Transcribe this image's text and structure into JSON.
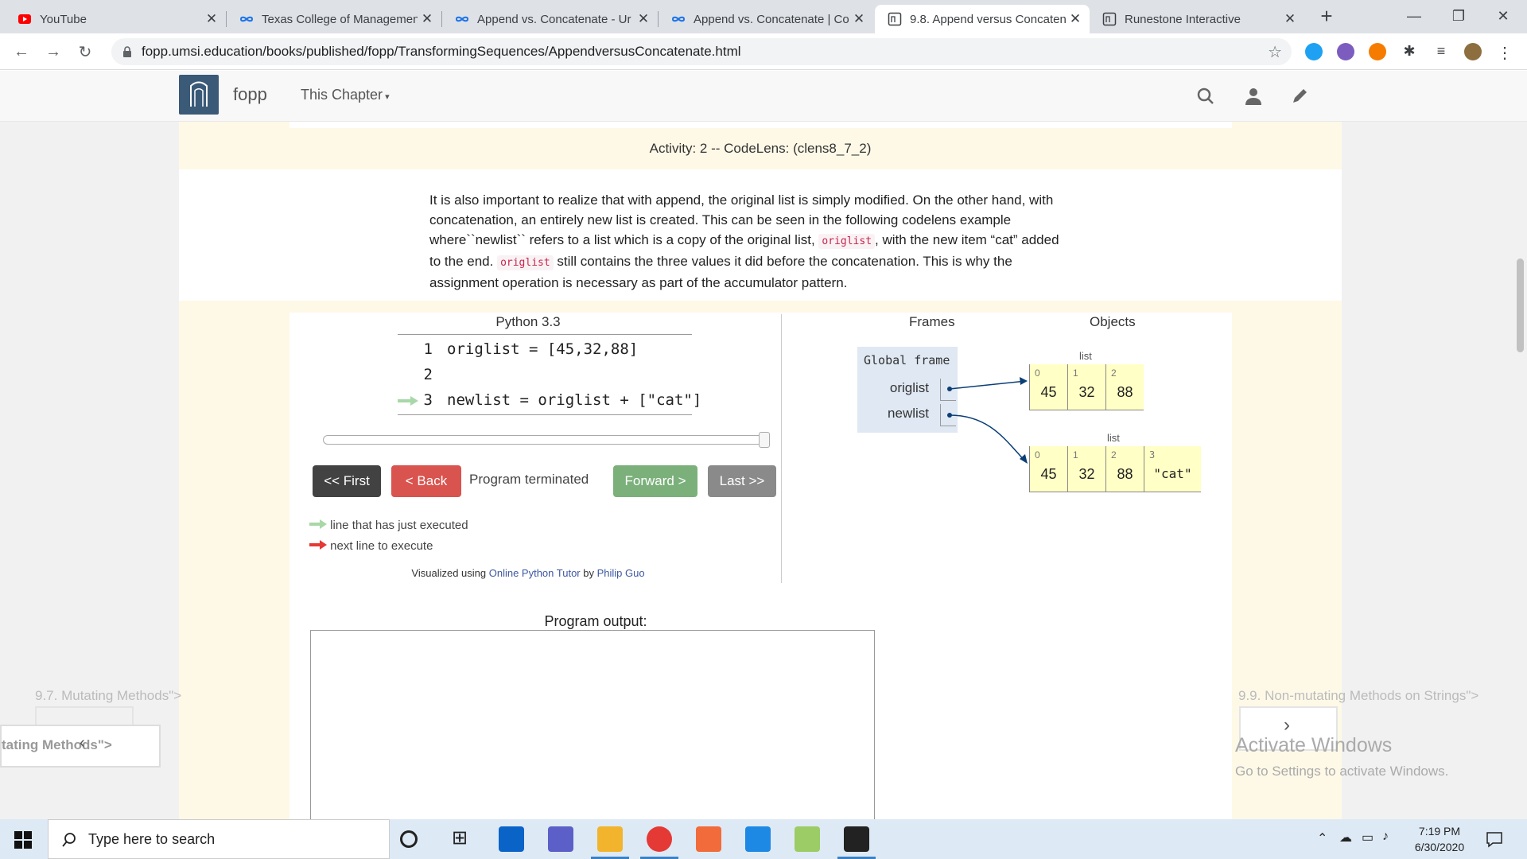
{
  "browser": {
    "tabs": [
      {
        "title": "YouTube",
        "icon": "youtube-icon",
        "active": false
      },
      {
        "title": "Texas College of Managemen",
        "icon": "infinity-icon",
        "active": false
      },
      {
        "title": "Append vs. Concatenate - Ur",
        "icon": "infinity-icon",
        "active": false
      },
      {
        "title": "Append vs. Concatenate | Co",
        "icon": "infinity-icon",
        "active": false
      },
      {
        "title": "9.8. Append versus Concaten",
        "icon": "runestone-icon",
        "active": true
      },
      {
        "title": "Runestone Interactive",
        "icon": "runestone-icon",
        "active": false
      }
    ],
    "url": "fopp.umsi.education/books/published/fopp/TransformingSequences/AppendversusConcatenate.html"
  },
  "site": {
    "brand": "fopp",
    "chapter_menu": "This Chapter"
  },
  "activity": {
    "label": "Activity: 2 -- CodeLens: (clens8_7_2)"
  },
  "paragraph": {
    "l1": "It is also important to realize that with append, the original list is simply modified. On the other hand, with",
    "l2": "concatenation, an entirely new list is created. This can be seen in the following codelens example",
    "l3a": "where``newlist`` refers to a list which is a copy of the original list, ",
    "code1": "origlist",
    "l3b": ", with the new item “cat” added",
    "l4a": "to the end. ",
    "code2": "origlist",
    "l4b": " still contains the three values it did before the concatenation. This is why the",
    "l5": "assignment operation is necessary as part of the accumulator pattern."
  },
  "codelens": {
    "language": "Python 3.3",
    "lines": [
      {
        "num": "1",
        "code": "origlist = [45,32,88]"
      },
      {
        "num": "2",
        "code": ""
      },
      {
        "num": "3",
        "code": "newlist = origlist + [\"cat\"]"
      }
    ],
    "step_fraction": 1.0,
    "buttons": {
      "first": "<< First",
      "back": "< Back",
      "forward": "Forward >",
      "last": "Last >>"
    },
    "status": "Program terminated",
    "legend_executed": "line that has just executed",
    "legend_next": "next line to execute",
    "credit_prefix": "Visualized using ",
    "credit_link1": "Online Python Tutor",
    "credit_mid": " by ",
    "credit_link2": "Philip Guo",
    "frames_header": "Frames",
    "objects_header": "Objects",
    "global_frame": "Global frame",
    "vars": [
      "origlist",
      "newlist"
    ],
    "list1_label": "list",
    "list1": [
      {
        "i": "0",
        "v": "45"
      },
      {
        "i": "1",
        "v": "32"
      },
      {
        "i": "2",
        "v": "88"
      }
    ],
    "list2_label": "list",
    "list2": [
      {
        "i": "0",
        "v": "45"
      },
      {
        "i": "1",
        "v": "32"
      },
      {
        "i": "2",
        "v": "88"
      },
      {
        "i": "3",
        "v": "\"cat\""
      }
    ],
    "output_label": "Program output:"
  },
  "pager": {
    "prev_text": "9.7. Mutating Methods\">",
    "prev_box_text": "tating Methods\">",
    "next_text": "9.9. Non-mutating Methods on Strings\">"
  },
  "watermark": {
    "title": "Activate Windows",
    "subtitle": "Go to Settings to activate Windows."
  },
  "taskbar": {
    "search_placeholder": "Type here to search",
    "time": "7:19 PM",
    "date": "6/30/2020"
  },
  "colors": {
    "first_btn": "#424242",
    "back_btn": "#d9534f",
    "forward_btn": "#7bb07b",
    "last_btn": "#8a8a8a",
    "arrow_green": "#a8d8a8",
    "arrow_red": "#e53935",
    "pointer": "#0a3e75"
  }
}
